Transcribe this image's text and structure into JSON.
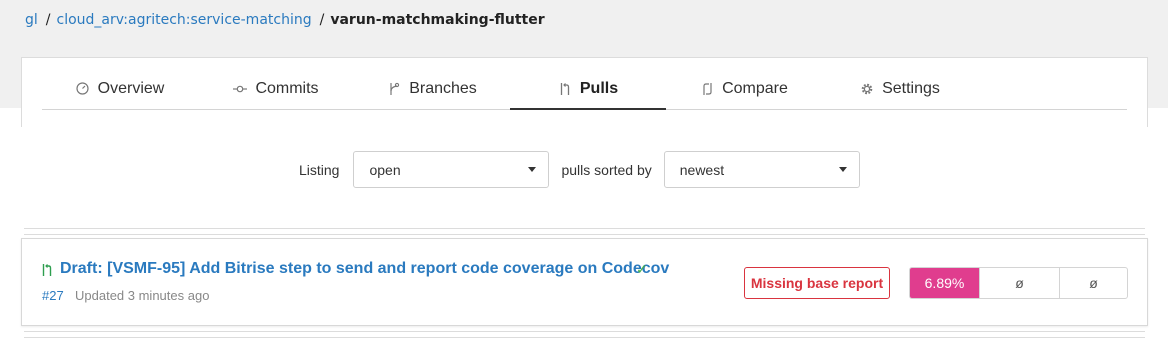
{
  "breadcrumb": {
    "org": "gl",
    "repo_group": "cloud_arv:agritech:service-matching",
    "repo": "varun-matchmaking-flutter",
    "separator": "/"
  },
  "tabs": [
    {
      "label": "Overview",
      "icon": "gauge-icon",
      "active": false
    },
    {
      "label": "Commits",
      "icon": "commit-icon",
      "active": false
    },
    {
      "label": "Branches",
      "icon": "branch-icon",
      "active": false
    },
    {
      "label": "Pulls",
      "icon": "pull-request-icon",
      "active": true
    },
    {
      "label": "Compare",
      "icon": "compare-icon",
      "active": false
    },
    {
      "label": "Settings",
      "icon": "gear-icon",
      "active": false
    }
  ],
  "filters": {
    "listing_label": "Listing",
    "listing_value": "open",
    "sorted_label": "pulls sorted by",
    "sorted_value": "newest"
  },
  "pulls": [
    {
      "title": "Draft: [VSMF-95] Add Bitrise step to send and report code coverage on Codecov",
      "check": "✓",
      "number": "#27",
      "updated": "Updated 3 minutes ago",
      "status_badge": "Missing base report",
      "coverage": [
        "6.89%",
        "ø",
        "ø"
      ]
    }
  ],
  "colors": {
    "link": "#2a7abf",
    "error": "#d9343f",
    "coverage_highlight": "#e03d8e",
    "success": "#49b34b"
  }
}
